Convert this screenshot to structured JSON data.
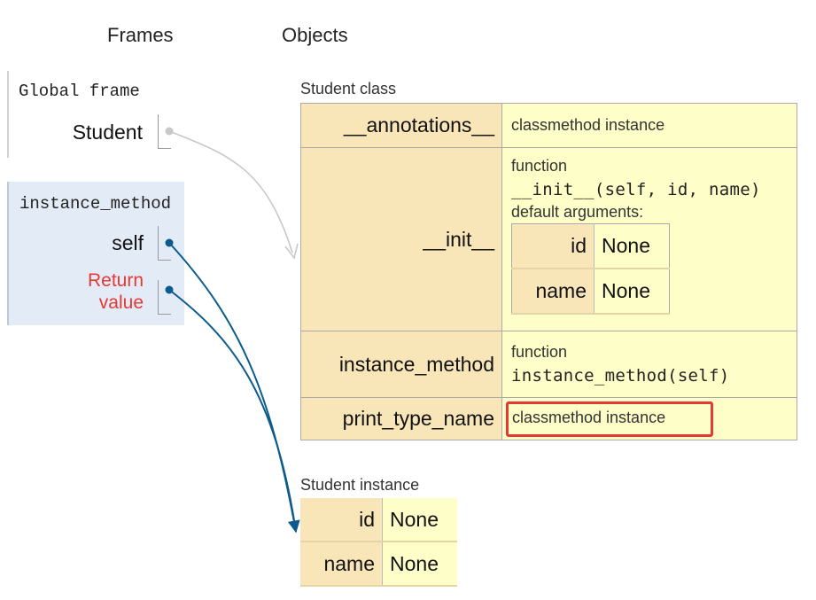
{
  "headers": {
    "frames": "Frames",
    "objects": "Objects"
  },
  "global_frame": {
    "title": "Global frame",
    "vars": [
      {
        "name": "Student"
      }
    ]
  },
  "method_frame": {
    "title": "instance_method",
    "self_label": "self",
    "return_label_line1": "Return",
    "return_label_line2": "value"
  },
  "student_class": {
    "label": "Student class",
    "rows": [
      {
        "key": "__annotations__",
        "value": "classmethod instance"
      },
      {
        "key": "__init__",
        "type": "function",
        "signature": "__init__(self, id, name)",
        "defaults_label": "default arguments:",
        "defaults": [
          {
            "key": "id",
            "value": "None"
          },
          {
            "key": "name",
            "value": "None"
          }
        ]
      },
      {
        "key": "instance_method",
        "type": "function",
        "signature": "instance_method(self)"
      },
      {
        "key": "print_type_name",
        "value": "classmethod instance",
        "highlighted": true
      }
    ]
  },
  "student_instance": {
    "label": "Student instance",
    "rows": [
      {
        "key": "id",
        "value": "None"
      },
      {
        "key": "name",
        "value": "None"
      }
    ]
  },
  "colors": {
    "pointer_active": "#0b5b8c",
    "pointer_inactive": "#c8c8c8",
    "highlight": "#e53935",
    "key_bg": "#f9e6b8",
    "value_bg": "#fefec8",
    "frame_bg": "#e2ebf6"
  }
}
